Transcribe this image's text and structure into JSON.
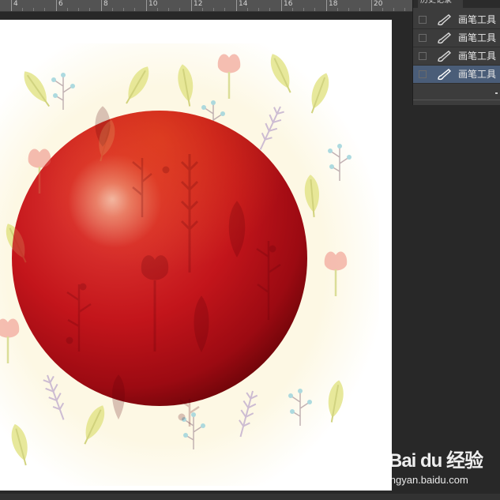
{
  "ruler": {
    "labels": [
      "4",
      "6",
      "8",
      "10",
      "12",
      "14",
      "16",
      "18",
      "20"
    ]
  },
  "history_panel": {
    "tab_title": "历史记录",
    "items": [
      {
        "label": "画笔工具",
        "icon": "brush-icon",
        "selected": false
      },
      {
        "label": "画笔工具",
        "icon": "brush-icon",
        "selected": false
      },
      {
        "label": "画笔工具",
        "icon": "brush-icon",
        "selected": false
      },
      {
        "label": "画笔工具",
        "icon": "brush-icon",
        "selected": true
      }
    ]
  },
  "watermark": {
    "logo": "Bai du 经验",
    "url": "jingyan.baidu.com"
  },
  "colors": {
    "workspace": "#282828",
    "panel": "#3c3c3c",
    "selection": "#4a5d78",
    "sphere": "#c8141b",
    "pattern_background": "#fdf8e4"
  }
}
